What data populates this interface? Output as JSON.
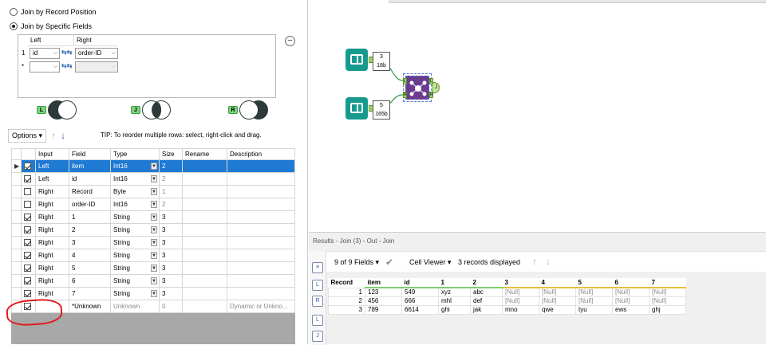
{
  "join_config": {
    "option_position": "Join by Record Position",
    "option_specific": "Join by Specific Fields",
    "grid_header_left": "Left",
    "grid_header_right": "Right",
    "rows": [
      {
        "num": "1",
        "left": "id",
        "right": "order-ID"
      },
      {
        "num": "*",
        "left": "",
        "right": ""
      }
    ],
    "venn": [
      {
        "tag": "L",
        "highlight": "left"
      },
      {
        "tag": "J",
        "highlight": "inner"
      },
      {
        "tag": "R",
        "highlight": "right"
      }
    ]
  },
  "toolbar": {
    "options_label": "Options",
    "tip": "TIP: To reorder multiple rows: select, right-click and drag."
  },
  "field_grid": {
    "headers": [
      "Input",
      "Field",
      "Type",
      "Size",
      "Rename",
      "Description"
    ],
    "rows": [
      {
        "checked": true,
        "input": "Left",
        "field": "item",
        "type": "Int16",
        "size": "2",
        "rename": "",
        "desc": "",
        "selected": true,
        "size_grey": false
      },
      {
        "checked": true,
        "input": "Left",
        "field": "id",
        "type": "Int16",
        "size": "2",
        "rename": "",
        "desc": "",
        "selected": false,
        "size_grey": true
      },
      {
        "checked": false,
        "input": "Right",
        "field": "Record",
        "type": "Byte",
        "size": "1",
        "rename": "",
        "desc": "",
        "selected": false,
        "size_grey": true
      },
      {
        "checked": false,
        "input": "Right",
        "field": "order-ID",
        "type": "Int16",
        "size": "2",
        "rename": "",
        "desc": "",
        "selected": false,
        "size_grey": true
      },
      {
        "checked": true,
        "input": "Right",
        "field": "1",
        "type": "String",
        "size": "3",
        "rename": "",
        "desc": "",
        "selected": false,
        "size_grey": false
      },
      {
        "checked": true,
        "input": "Right",
        "field": "2",
        "type": "String",
        "size": "3",
        "rename": "",
        "desc": "",
        "selected": false,
        "size_grey": false
      },
      {
        "checked": true,
        "input": "Right",
        "field": "3",
        "type": "String",
        "size": "3",
        "rename": "",
        "desc": "",
        "selected": false,
        "size_grey": false
      },
      {
        "checked": true,
        "input": "Right",
        "field": "4",
        "type": "String",
        "size": "3",
        "rename": "",
        "desc": "",
        "selected": false,
        "size_grey": false
      },
      {
        "checked": true,
        "input": "Right",
        "field": "5",
        "type": "String",
        "size": "3",
        "rename": "",
        "desc": "",
        "selected": false,
        "size_grey": false
      },
      {
        "checked": true,
        "input": "Right",
        "field": "6",
        "type": "String",
        "size": "3",
        "rename": "",
        "desc": "",
        "selected": false,
        "size_grey": false
      },
      {
        "checked": true,
        "input": "Right",
        "field": "7",
        "type": "String",
        "size": "3",
        "rename": "",
        "desc": "",
        "selected": false,
        "size_grey": false
      },
      {
        "checked": true,
        "input": "",
        "field": "*Unknown",
        "type": "Unknown",
        "size": "0",
        "rename": "",
        "desc": "Dynamic or Unkno...",
        "selected": false,
        "size_grey": true,
        "unknown": true
      }
    ]
  },
  "workflow": {
    "input1_badge": [
      "3",
      "18b"
    ],
    "input2_badge": [
      "5",
      "165b"
    ],
    "join_ports": [
      "L",
      "R",
      "L",
      "J",
      "R"
    ]
  },
  "results": {
    "title": "Results - Join (3) - Out - Join",
    "fields_label": "9 of 9 Fields",
    "viewer_label": "Cell Viewer",
    "records_label": "3 records displayed",
    "side_icons": [
      "L",
      "R",
      "L",
      "J"
    ],
    "headers": [
      "Record",
      "item",
      "id",
      "1",
      "2",
      "3",
      "4",
      "5",
      "6",
      "7"
    ],
    "rows": [
      [
        "1",
        "123",
        "549",
        "xyz",
        "abc",
        "[Null]",
        "[Null]",
        "[Null]",
        "[Null]",
        "[Null]"
      ],
      [
        "2",
        "456",
        "666",
        "mhl",
        "def",
        "[Null]",
        "[Null]",
        "[Null]",
        "[Null]",
        "[Null]"
      ],
      [
        "3",
        "789",
        "6614",
        "ghi",
        "jak",
        "mno",
        "qwe",
        "tyu",
        "ews",
        "ghj"
      ]
    ]
  },
  "colors": {
    "selected_row": "#1f7ad3",
    "tool_teal": "#169a8e",
    "join_purple": "#6b3b8e",
    "annotation_red": "#e01a1a"
  }
}
